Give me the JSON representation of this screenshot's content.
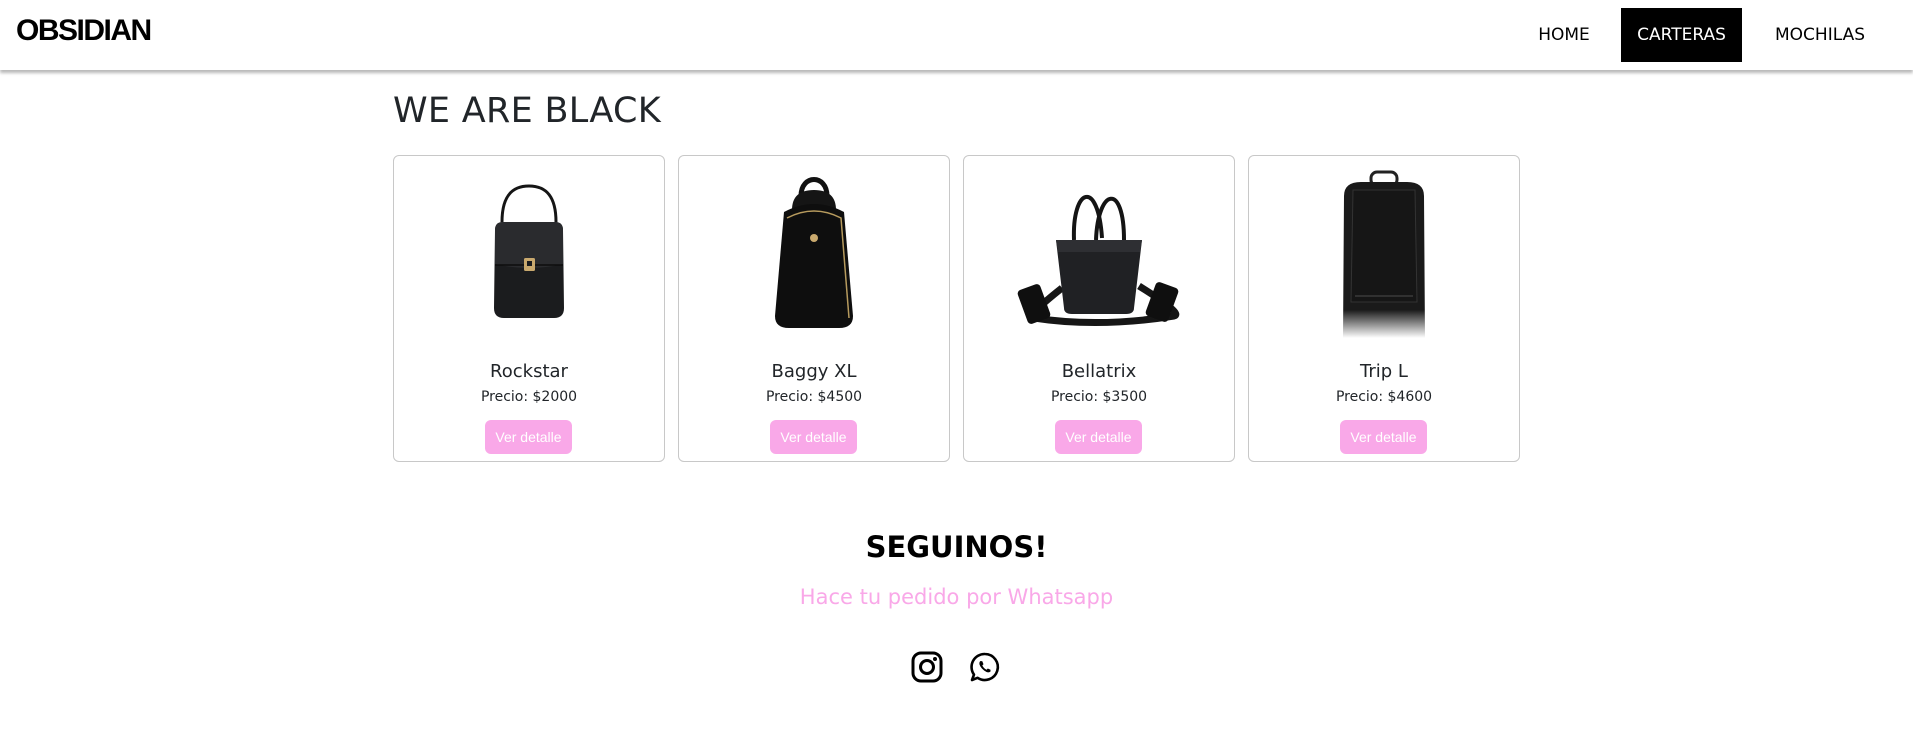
{
  "navbar": {
    "brand": "OBSIDIAN",
    "links": [
      {
        "label": "HOME",
        "active": false
      },
      {
        "label": "CARTERAS",
        "active": true
      },
      {
        "label": "MOCHILAS",
        "active": false
      }
    ]
  },
  "main": {
    "title": "WE ARE BLACK",
    "products": [
      {
        "name": "Rockstar",
        "price": "Precio: $2000",
        "button": "Ver detalle",
        "image_icon": "handbag-icon"
      },
      {
        "name": "Baggy XL",
        "price": "Precio: $4500",
        "button": "Ver detalle",
        "image_icon": "backpack-icon"
      },
      {
        "name": "Bellatrix",
        "price": "Precio: $3500",
        "button": "Ver detalle",
        "image_icon": "tote-bag-icon"
      },
      {
        "name": "Trip L",
        "price": "Precio: $4600",
        "button": "Ver detalle",
        "image_icon": "laptop-backpack-icon"
      }
    ]
  },
  "footer": {
    "title": "SEGUINOS!",
    "whatsapp_text": "Hace tu pedido por Whatsapp",
    "social": [
      "instagram-icon",
      "whatsapp-icon"
    ]
  },
  "colors": {
    "accent": "#f9a8e8",
    "nav_active_bg": "#000000",
    "text": "#212529"
  }
}
